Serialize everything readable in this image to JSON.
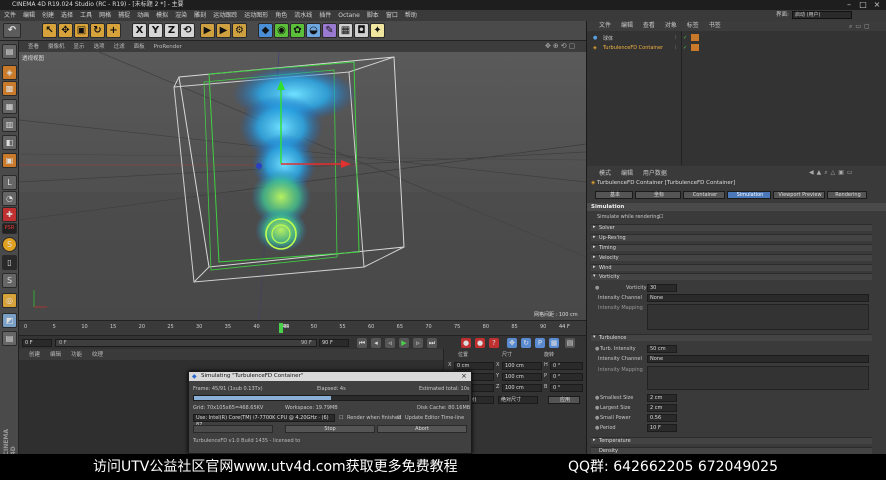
{
  "window": {
    "title": "CINEMA 4D R19.024 Studio (RC - R19) - [未标题 2 *] - 主要"
  },
  "menu": [
    "文件",
    "编辑",
    "创建",
    "选择",
    "工具",
    "网格",
    "捕捉",
    "动画",
    "模拟",
    "渲染",
    "雕刻",
    "运动跟踪",
    "运动图形",
    "角色",
    "流水线",
    "插件",
    "Octane",
    "脚本",
    "窗口",
    "帮助"
  ],
  "interface": {
    "label": "界面:",
    "value": "启动 (用户)"
  },
  "toolbar": {
    "axes": [
      "X",
      "Y",
      "Z"
    ]
  },
  "viewport": {
    "menu": [
      "查看",
      "摄像机",
      "显示",
      "选项",
      "过滤",
      "面板",
      "ProRender"
    ],
    "label": "透视视图",
    "grid_label": "网格间距 : 100 cm"
  },
  "timeline": {
    "ticks": [
      "0",
      "5",
      "10",
      "15",
      "20",
      "25",
      "30",
      "35",
      "40",
      "45",
      "50",
      "55",
      "60",
      "65",
      "70",
      "75",
      "80",
      "85",
      "90"
    ],
    "current": "44",
    "end_label": "44 F",
    "start_field": "0 F",
    "start_field2": "0 F",
    "end_field": "90 F",
    "end_field2": "90 F"
  },
  "material_menu": [
    "创建",
    "编辑",
    "功能",
    "纹理"
  ],
  "coords": {
    "headers": [
      "位置",
      "尺寸",
      "旋转"
    ],
    "rows": [
      {
        "a": "X",
        "v1": "0 cm",
        "b": "X",
        "v2": "100 cm",
        "c": "H",
        "v3": "0 °"
      },
      {
        "a": "Y",
        "v1": "0 cm",
        "b": "Y",
        "v2": "100 cm",
        "c": "P",
        "v3": "0 °"
      },
      {
        "a": "Z",
        "v1": "0 cm",
        "b": "Z",
        "v2": "100 cm",
        "c": "B",
        "v3": "0 °"
      }
    ],
    "mode1": "对象 (相对)",
    "mode2": "绝对尺寸",
    "apply": "应用"
  },
  "object_manager": {
    "menu": [
      "文件",
      "编辑",
      "查看",
      "对象",
      "标签",
      "书签"
    ],
    "items": [
      "球体",
      "TurbulenceFD Container"
    ]
  },
  "attributes": {
    "menu": [
      "模式",
      "编辑",
      "用户数据"
    ],
    "title": "TurbulenceFD Container [TurbulenceFD Container]",
    "tabs": [
      "基本",
      "坐标",
      "Container",
      "Simulation",
      "Viewport Preview",
      "Rendering"
    ],
    "active_tab": "Simulation",
    "section": "Simulation",
    "simulate_label": "Simulate while rendering",
    "groups": [
      "Solver",
      "Up-Res'ing",
      "Timing",
      "Velocity",
      "Wind",
      "Vorticity"
    ],
    "vorticity": {
      "label": "Vorticity",
      "value": "30",
      "channel_label": "Intensity Channel",
      "channel_value": "None",
      "mapping_label": "Intensity Mapping"
    },
    "turb_section": "Turbulence",
    "turbulence": {
      "intensity_label": "Turb. Intensity",
      "intensity_value": "50 cm",
      "channel_label": "Intensity Channel",
      "channel_value": "None",
      "mapping_label": "Intensity Mapping",
      "smallest_label": "Smallest Size",
      "smallest_value": "2 cm",
      "largest_label": "Largest Size",
      "largest_value": "2 cm",
      "small_power_label": "Small Power",
      "small_power_value": "0.56",
      "period_label": "Period",
      "period_value": "10 F"
    },
    "bottom_sections": [
      "Temperature",
      "Density"
    ]
  },
  "dialog": {
    "title": "Simulating \"TurbulenceFD Container\"",
    "frame": "Frame: 45/91 (1sub 0.13Tx)",
    "elapsed": "Elapsed: 4s",
    "estimated": "Estimated total: 10s",
    "progress": 0.5,
    "grid": "Grid: 70x105x65=468.65KV",
    "workspace": "Workspace: 19.79MB",
    "disk_cache": "Disk Cache: 80.16MB",
    "device": "Use: Intel(R) Core(TM) i7-7700K CPU @ 4.20GHz · (6) 87",
    "render_label": "Render when finished",
    "update_label": "Update Editor Time-line",
    "stop": "Stop",
    "abort": "Abort",
    "footer": "TurbulenceFD v1.0 Build 1435 - licensed to"
  },
  "banner": {
    "left": "访问UTV公益社区官网www.utv4d.com获取更多免费教程",
    "right": "QQ群: 642662205  672049025"
  },
  "side_label": "CINEMA 4D"
}
